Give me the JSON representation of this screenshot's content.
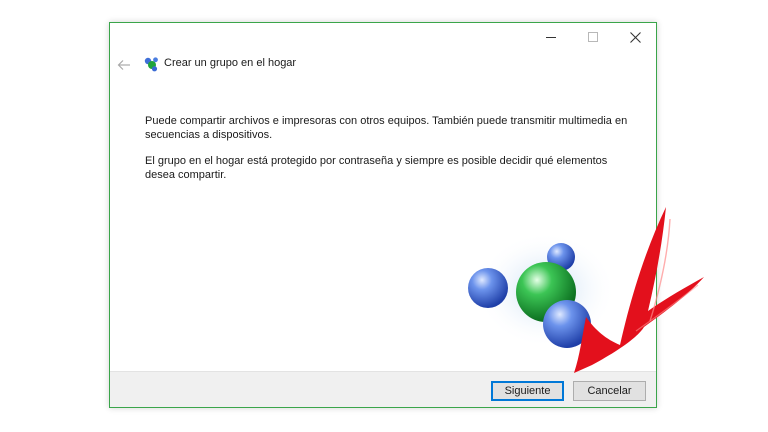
{
  "window": {
    "title": "Crear un grupo en el hogar",
    "caption": {
      "minimize_icon": "minimize-icon",
      "maximize_icon": "maximize-icon",
      "close_icon": "close-icon"
    },
    "back_icon": "back-arrow-icon",
    "app_icon": "homegroup-icon"
  },
  "content": {
    "paragraph1": "Puede compartir archivos e impresoras con otros equipos. También puede transmitir multimedia en secuencias a dispositivos.",
    "paragraph2": "El grupo en el hogar está protegido por contraseña y siempre es posible decidir qué elementos desea compartir."
  },
  "graphic": {
    "icon": "homegroup-spheres-graphic"
  },
  "footer": {
    "next_label": "Siguiente",
    "cancel_label": "Cancelar"
  },
  "annotation": {
    "icon": "red-checkmark-arrow"
  },
  "colors": {
    "window_border": "#3aa54a",
    "primary_button_border": "#0078d7",
    "footer_bg": "#f0f0f0",
    "arrow_red": "#e3101c",
    "sphere_blue": "#3f6fd8",
    "sphere_green": "#1fa43a"
  }
}
